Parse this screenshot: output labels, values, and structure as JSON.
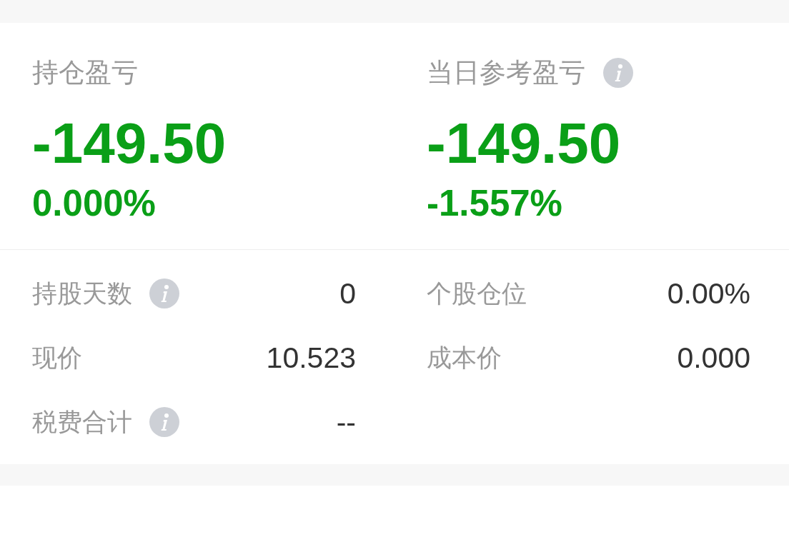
{
  "summary": [
    {
      "label": "持仓盈亏",
      "info": false,
      "value": "-149.50",
      "percent": "0.000%"
    },
    {
      "label": "当日参考盈亏",
      "info": true,
      "value": "-149.50",
      "percent": "-1.557%"
    }
  ],
  "details": [
    {
      "label": "持股天数",
      "info": true,
      "value": "0"
    },
    {
      "label": "个股仓位",
      "info": false,
      "value": "0.00%"
    },
    {
      "label": "现价",
      "info": false,
      "value": "10.523"
    },
    {
      "label": "成本价",
      "info": false,
      "value": "0.000"
    },
    {
      "label": "税费合计",
      "info": true,
      "value": "--"
    }
  ]
}
